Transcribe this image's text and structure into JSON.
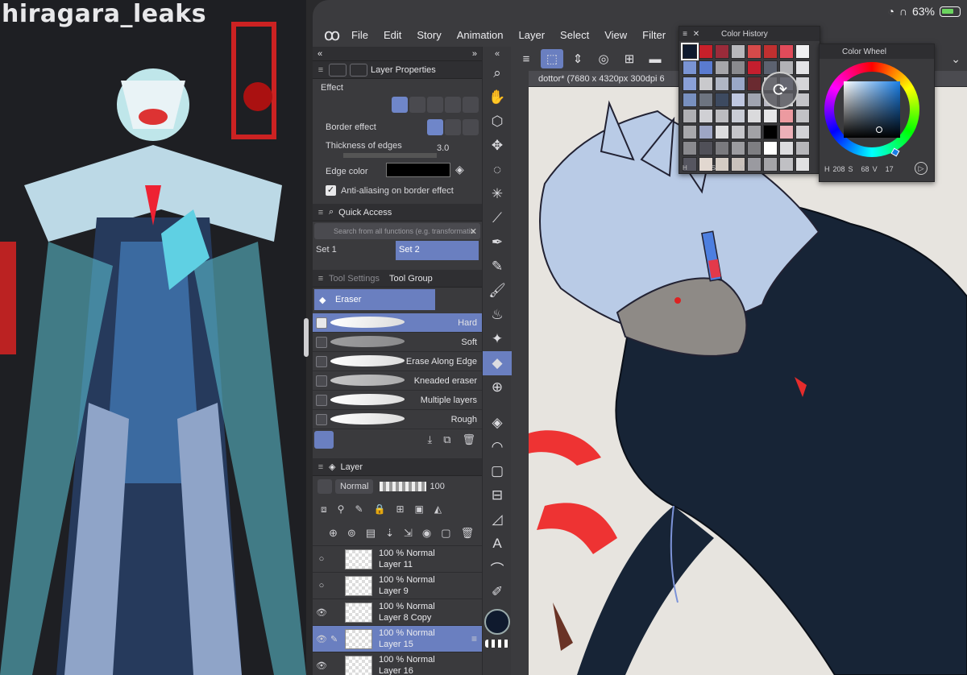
{
  "watermark": "hiragara_leaks",
  "status": {
    "battery": "63%"
  },
  "menu": [
    "File",
    "Edit",
    "Story",
    "Animation",
    "Layer",
    "Select",
    "View",
    "Filter"
  ],
  "layer_properties": {
    "title": "Layer Properties",
    "section": "Effect",
    "border_effect_label": "Border effect",
    "thickness_label": "Thickness of edges",
    "thickness_value": "3.0",
    "edge_color_label": "Edge color",
    "antialias_label": "Anti-aliasing on border effect",
    "antialias_checked": true
  },
  "quick_access": {
    "title": "Quick Access",
    "search_placeholder": "Search from all functions (e.g. transformatio",
    "set1": "Set 1",
    "set2": "Set 2"
  },
  "tool_panel": {
    "tab_settings": "Tool Settings",
    "tab_group": "Tool Group",
    "group_name": "Eraser",
    "items": [
      {
        "label": "Hard",
        "selected": true
      },
      {
        "label": "Soft",
        "selected": false
      },
      {
        "label": "Erase Along Edge",
        "selected": false
      },
      {
        "label": "Kneaded eraser",
        "selected": false
      },
      {
        "label": "Multiple layers",
        "selected": false
      },
      {
        "label": "Rough",
        "selected": false
      }
    ]
  },
  "layer_panel": {
    "title": "Layer",
    "blend_mode": "Normal",
    "opacity": "100",
    "layers": [
      {
        "line1": "100 %  Normal",
        "line2": "Layer 11",
        "visible": false,
        "selected": false
      },
      {
        "line1": "100 %  Normal",
        "line2": "Layer 9",
        "visible": false,
        "selected": false
      },
      {
        "line1": "100 %  Normal",
        "line2": "Layer 8 Copy",
        "visible": true,
        "selected": false
      },
      {
        "line1": "100 %  Normal",
        "line2": "Layer 15",
        "visible": true,
        "selected": true
      },
      {
        "line1": "100 %  Normal",
        "line2": "Layer 16",
        "visible": true,
        "selected": false
      }
    ]
  },
  "document_tab": "dottor* (7680 x 4320px 300dpi 6",
  "color_history": {
    "title": "Color History",
    "footer": [
      "H",
      "S",
      "V"
    ],
    "colors": [
      "#0f1a2e",
      "#c8202a",
      "#9a2b3a",
      "#b8b8bc",
      "#d64a4a",
      "#c03030",
      "#e14b5a",
      "#f0f0f2",
      "#7a94d4",
      "#5a7bd0",
      "#a6a6aa",
      "#8a8a8e",
      "#c41e2e",
      "#5c6270",
      "#b2b2b6",
      "#e3e3e6",
      "#8aa0d8",
      "#c9c9cc",
      "#b0b6c4",
      "#9aa8c8",
      "#6a2a30",
      "#c8c8cc",
      "#a8b0d6",
      "#d4d4d8",
      "#7890c0",
      "#6d7480",
      "#3d4a60",
      "#bfc7e0",
      "#a0a4b0",
      "#b8b8c4",
      "#d8d8da",
      "#c4c4c8",
      "#b0b0b4",
      "#d0d0d4",
      "#bcbcc0",
      "#cacdd6",
      "#dadadc",
      "#e6e6e8",
      "#ec9aa0",
      "#c2c2c6",
      "#a8a8ac",
      "#9ea6c4",
      "#dcdcde",
      "#c6c6ca",
      "#a2a2a6",
      "#000000",
      "#ecb0b8",
      "#d2d2d6",
      "#8a8a8e",
      "#505058",
      "#7a7a7e",
      "#9c9ca0",
      "#7e7e82",
      "#ffffff",
      "#dcdcdf",
      "#b6b6ba",
      "#565660",
      "#e2d8d0",
      "#d4ccc4",
      "#cac2bc",
      "#9a9aa0",
      "#a4a4a8",
      "#c0c0c4",
      "#e0e0e2"
    ]
  },
  "color_wheel": {
    "title": "Color Wheel",
    "h_label": "H",
    "h": "208",
    "s_label": "S",
    "s": "68",
    "v_label": "V",
    "v": "17",
    "current": "#0f1a2e"
  }
}
